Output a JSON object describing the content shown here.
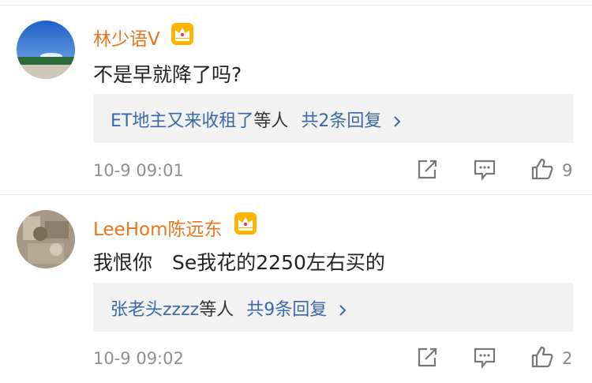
{
  "comments": [
    {
      "username": "林少语V",
      "text": "不是早就降了吗?",
      "replies": {
        "names": "ET地主又来收租了",
        "suffix": "等人",
        "count_label": "共2条回复"
      },
      "time": "10-9 09:01",
      "likes": "9"
    },
    {
      "username": "LeeHom陈远东",
      "text": "我恨你　Se我花的2250左右买的",
      "replies": {
        "names": "张老头zzzz",
        "suffix": "等人",
        "count_label": "共9条回复"
      },
      "time": "10-9 09:02",
      "likes": "2"
    }
  ],
  "icons": [
    "crown-badge-icon",
    "share-icon",
    "comment-icon",
    "like-icon",
    "chevron-right-icon"
  ],
  "colors": {
    "username": "#e8761d",
    "reply_link": "#3d68a7",
    "reply_bg": "#f2f2f2",
    "time": "#8f8f8f"
  }
}
